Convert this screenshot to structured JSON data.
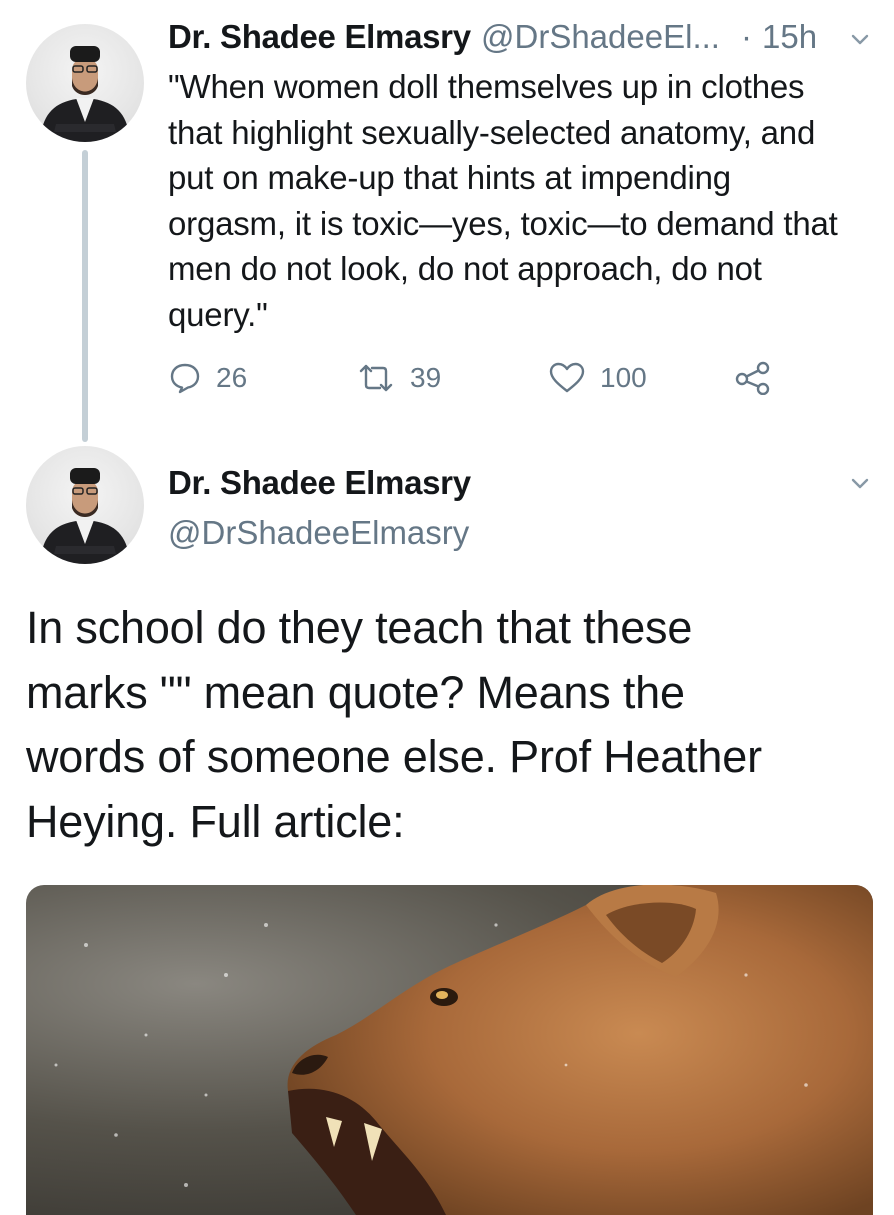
{
  "tweet1": {
    "display_name": "Dr. Shadee Elmasry",
    "handle": "@DrShadeeEl...",
    "time_separator": "·",
    "time": "15h",
    "text": "\"When women doll themselves up in clothes\nthat highlight sexually-selected anatomy, and\nput on make-up that hints at impending\norgasm, it is toxic—yes, toxic—to demand that\nmen do not look, do not approach, do not\nquery.\"",
    "actions": {
      "reply_icon": "reply-icon",
      "reply_count": "26",
      "retweet_icon": "retweet-icon",
      "retweet_count": "39",
      "like_icon": "heart-icon",
      "like_count": "100",
      "share_icon": "share-icon"
    }
  },
  "tweet2": {
    "display_name": "Dr. Shadee Elmasry",
    "handle": "@DrShadeeElmasry",
    "text": "In school do they teach that these\nmarks \"\" mean quote? Means the\nwords of someone else. Prof Heather\nHeying. Full article:",
    "media_icon": "lioness-photo"
  },
  "colors": {
    "text": "#14171a",
    "secondary": "#657786",
    "thread_line": "#c4cfd6",
    "chevron": "#8899a6"
  }
}
